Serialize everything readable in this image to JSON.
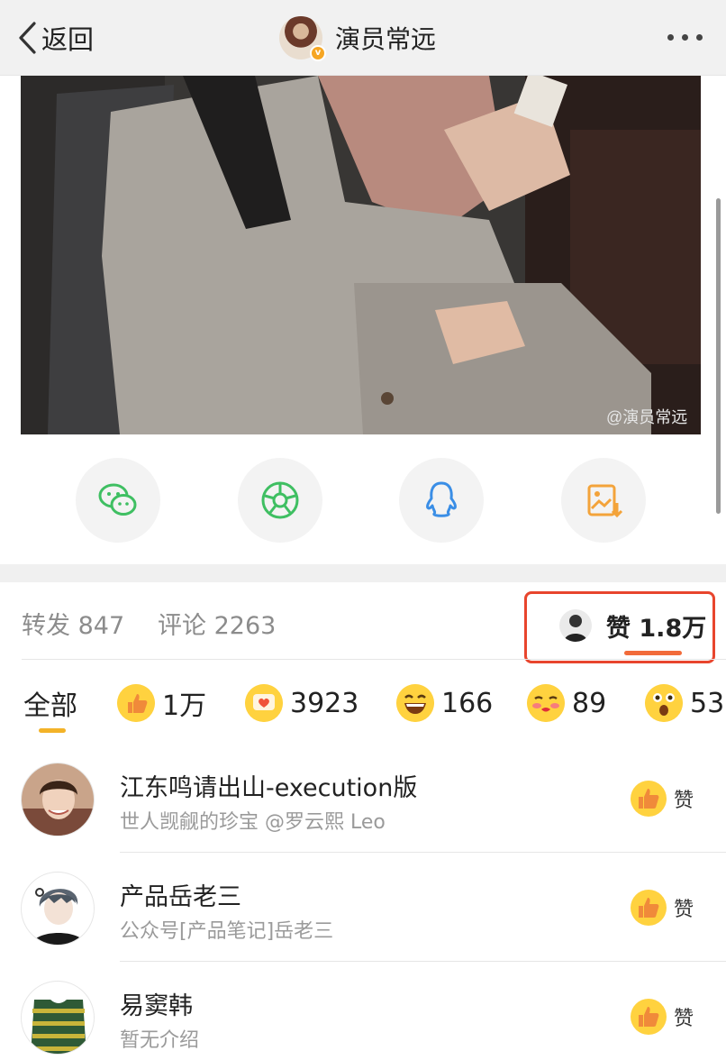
{
  "nav": {
    "back_label": "返回",
    "title": "演员常远"
  },
  "photo": {
    "watermark": "@演员常远"
  },
  "share": [
    "wechat-icon",
    "moments-icon",
    "qq-icon",
    "save-image-icon"
  ],
  "stats": {
    "repost": "转发 847",
    "comment": "评论 2263",
    "like": "赞 1.8万"
  },
  "tabs": {
    "all": "全部",
    "thumb": "1万",
    "love": "3923",
    "laugh": "166",
    "kiss": "89",
    "surprise": "53"
  },
  "users": [
    {
      "name": "江东鸣请出山-execution版",
      "desc": "世人觊觎的珍宝 @罗云熙 Leo",
      "like_label": "赞"
    },
    {
      "name": "产品岳老三",
      "desc": "公众号[产品笔记]岳老三",
      "like_label": "赞"
    },
    {
      "name": "易窦韩",
      "desc": "暂无介绍",
      "like_label": "赞"
    }
  ],
  "colors": {
    "accent_orange": "#f26b3a",
    "highlight_box": "#e8452d",
    "tab_underline": "#f3b328",
    "wechat_green": "#3fbf62",
    "qq_blue": "#3a8ee6",
    "save_orange": "#f3a33a"
  }
}
